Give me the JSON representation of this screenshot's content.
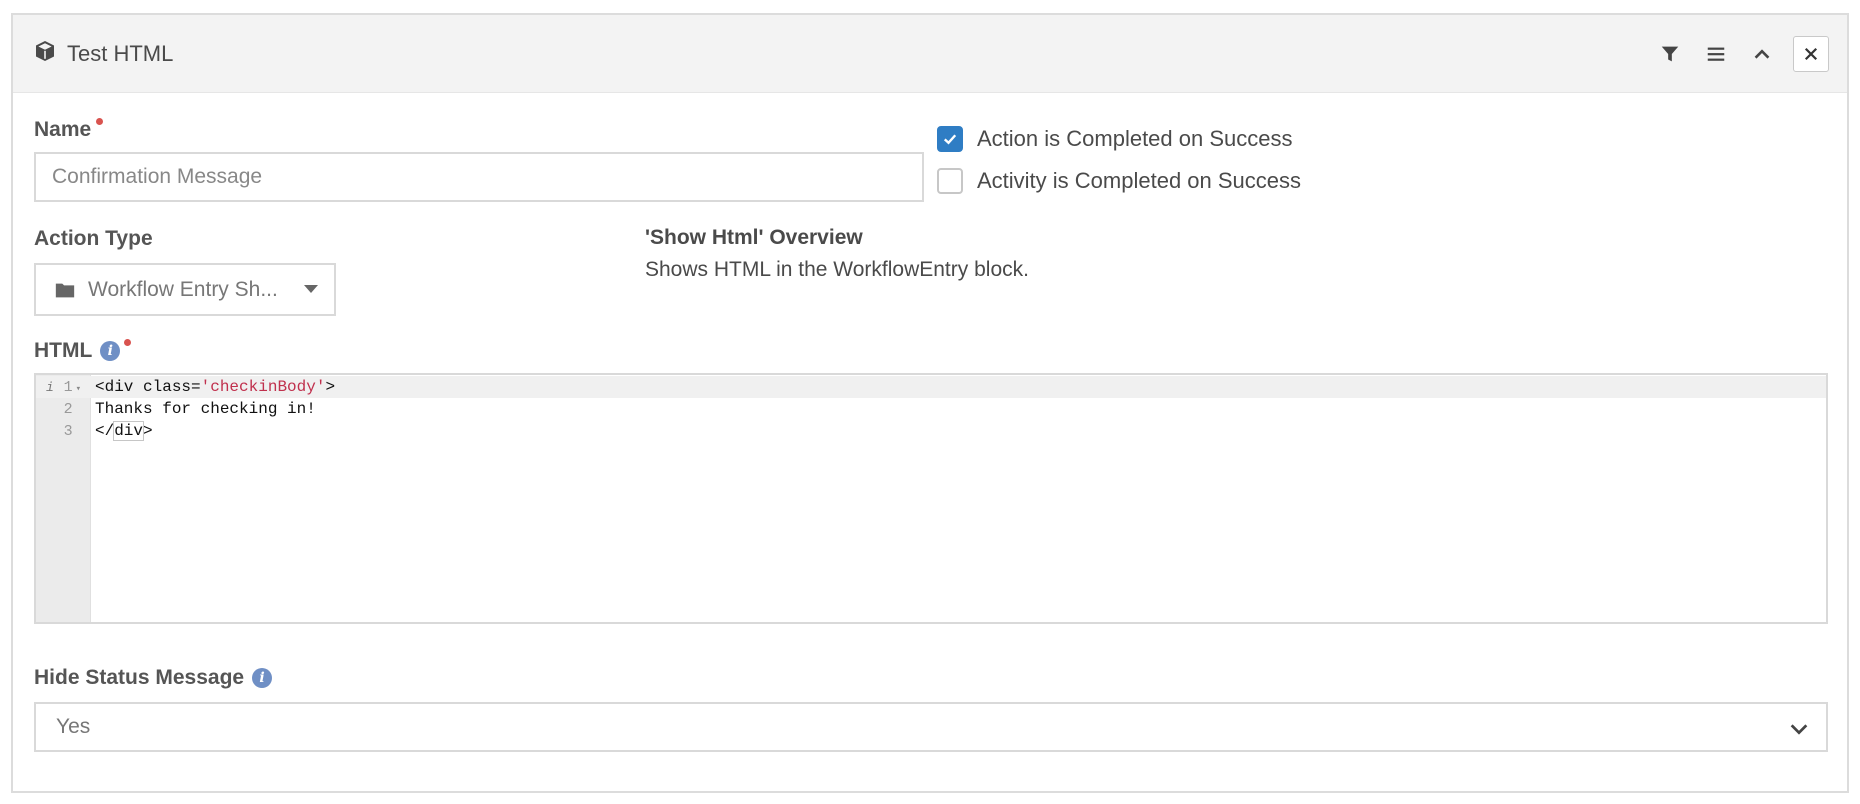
{
  "panel": {
    "title": "Test HTML",
    "actions": [
      "filter-icon",
      "menu-icon",
      "chevron-up-icon",
      "close-icon"
    ]
  },
  "name_field": {
    "label": "Name",
    "value": "",
    "placeholder": "Confirmation Message",
    "required": true
  },
  "checkboxes": [
    {
      "label": "Action is Completed on Success",
      "checked": true
    },
    {
      "label": "Activity is Completed on Success",
      "checked": false
    }
  ],
  "action_type": {
    "label": "Action Type",
    "value": "Workflow Entry Sh...",
    "icon": "folder-icon"
  },
  "overview": {
    "title": "'Show Html' Overview",
    "text": "Shows HTML in the WorkflowEntry block."
  },
  "html_field": {
    "label": "HTML",
    "required": true,
    "lines": [
      {
        "num": "1",
        "pre": "<div class=",
        "str": "'checkinBody'",
        "post": ">"
      },
      {
        "num": "2",
        "text": "Thanks for checking in!"
      },
      {
        "num": "3",
        "pre": "</",
        "bracket": "div",
        "post": ">"
      }
    ]
  },
  "hide_status": {
    "label": "Hide Status Message",
    "value": "Yes"
  },
  "colors": {
    "accent": "#2f7dc4",
    "required": "#d9534f",
    "info": "#6f8fc5",
    "string": "#c0304d"
  }
}
